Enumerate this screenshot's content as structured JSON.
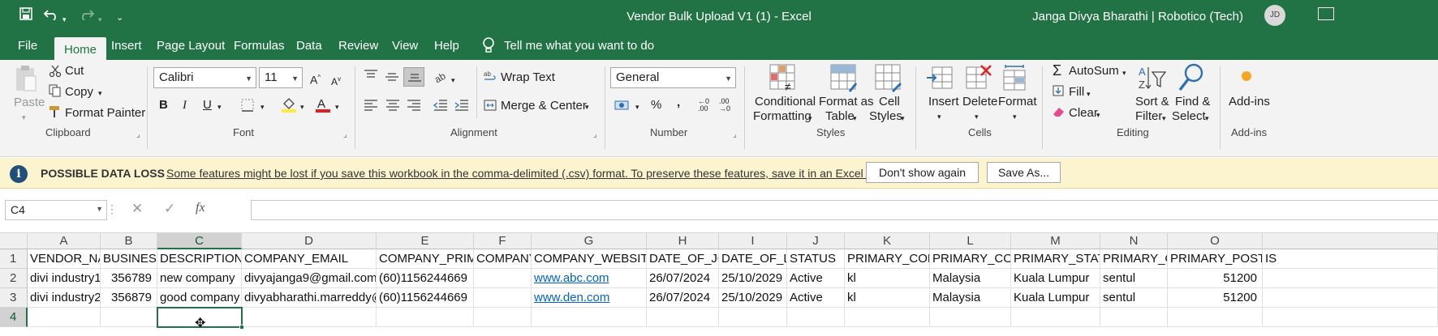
{
  "window": {
    "title": "Vendor Bulk Upload V1 (1)  -  Excel",
    "user": "Janga Divya Bharathi | Robotico (Tech)",
    "avatar": "JD",
    "quick_access": {
      "save_icon": "save-icon",
      "undo_icon": "undo-icon",
      "redo_icon": "redo-icon",
      "customize_icon": "customize-quick-access-icon"
    }
  },
  "tabs": [
    "File",
    "Home",
    "Insert",
    "Page Layout",
    "Formulas",
    "Data",
    "Review",
    "View",
    "Help"
  ],
  "active_tab": "Home",
  "tell_me": "Tell me what you want to do",
  "ribbon": {
    "clipboard": {
      "paste": "Paste",
      "cut": "Cut",
      "copy": "Copy",
      "format_painter": "Format Painter",
      "group": "Clipboard"
    },
    "font": {
      "name": "Calibri",
      "size": "11",
      "group": "Font",
      "bold": "B",
      "italic": "I",
      "underline": "U"
    },
    "alignment": {
      "wrap": "Wrap Text",
      "merge": "Merge & Center",
      "group": "Alignment"
    },
    "number": {
      "format": "General",
      "group": "Number",
      "percent": "%",
      "comma": ","
    },
    "styles": {
      "conditional": "Conditional",
      "conditional2": "Formatting",
      "format_as": "Format as",
      "table": "Table",
      "cell": "Cell",
      "styles": "Styles",
      "group": "Styles"
    },
    "cells": {
      "insert": "Insert",
      "delete": "Delete",
      "format": "Format",
      "group": "Cells"
    },
    "editing": {
      "autosum": "AutoSum",
      "fill": "Fill",
      "clear": "Clear",
      "sort": "Sort &",
      "filter": "Filter",
      "find": "Find &",
      "select": "Select",
      "group": "Editing"
    },
    "addins": {
      "label": "Add-ins",
      "group": "Add-ins"
    }
  },
  "infobar": {
    "heading": "POSSIBLE DATA LOSS",
    "message": "Some features might be lost if you save this workbook in the comma-delimited (.csv) format. To preserve these features, save it in an Excel file format.",
    "dont_show": "Don't show again",
    "save_as": "Save As..."
  },
  "formula_bar": {
    "name_box": "C4",
    "fx": "fx",
    "value": ""
  },
  "colors": {
    "excel_green": "#217346",
    "info_yellow": "#fcf3cf",
    "link_blue": "#0563c1"
  },
  "sheet": {
    "columns": [
      "A",
      "B",
      "C",
      "D",
      "E",
      "F",
      "G",
      "H",
      "I",
      "J",
      "K",
      "L",
      "M",
      "N",
      "O",
      ""
    ],
    "rows": [
      "1",
      "2",
      "3",
      "4"
    ],
    "selected_column": "C",
    "selected_row": "4",
    "cells": [
      [
        "VENDOR_NAM",
        "BUSINESS_",
        "DESCRIPTION",
        "COMPANY_EMAIL",
        "COMPANY_PRIMA",
        "COMPANY",
        "COMPANY_WEBSITE",
        "DATE_OF_JO",
        "DATE_OF_LE",
        "STATUS",
        "PRIMARY_COM",
        "PRIMARY_COU",
        "PRIMARY_STATE",
        "PRIMARY_CI",
        "PRIMARY_POSTC",
        "IS"
      ],
      [
        "divi industry1",
        "356789",
        "new company",
        "divyajanga9@gmail.com",
        "(60)1156244669",
        "",
        "www.abc.com",
        "26/07/2024",
        "25/10/2029",
        "Active",
        "kl",
        "Malaysia",
        "Kuala Lumpur",
        "sentul",
        "51200",
        ""
      ],
      [
        "divi industry2",
        "356879",
        "good company",
        "divyabharathi.marreddy@",
        "(60)1156244669",
        "",
        "www.den.com",
        "26/07/2024",
        "25/10/2029",
        "Active",
        "kl",
        "Malaysia",
        "Kuala Lumpur",
        "sentul",
        "51200",
        ""
      ],
      [
        "",
        "",
        "",
        "",
        "",
        "",
        "",
        "",
        "",
        "",
        "",
        "",
        "",
        "",
        "",
        ""
      ]
    ]
  }
}
